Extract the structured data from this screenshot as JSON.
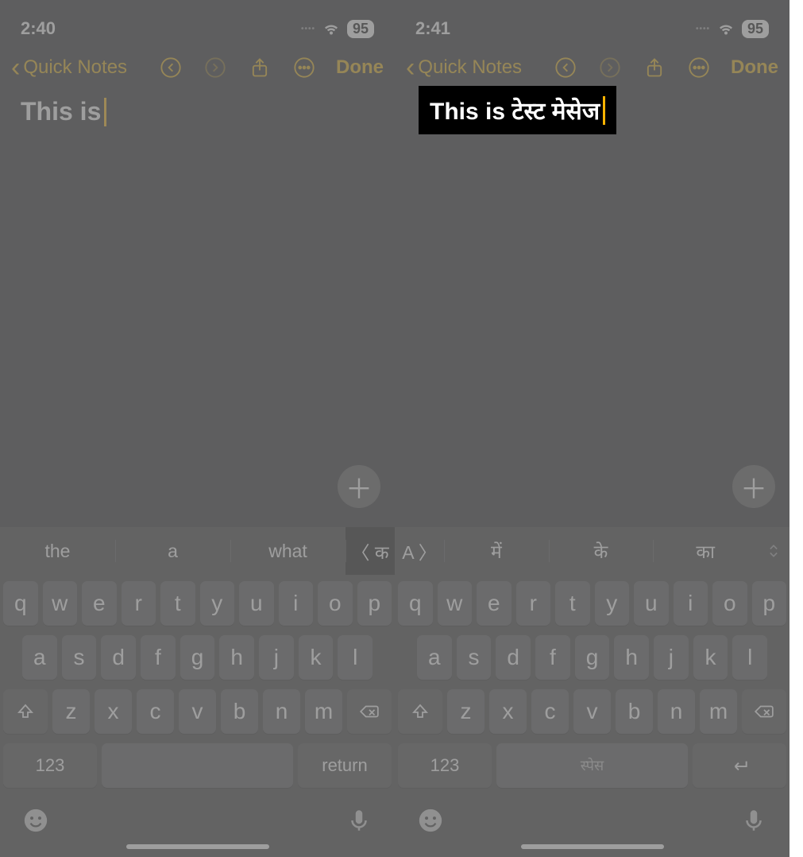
{
  "left": {
    "time": "2:40",
    "battery": "95",
    "back_label": "Quick Notes",
    "done_label": "Done",
    "note_text": "This is",
    "suggestions": [
      "the",
      "a",
      "what"
    ],
    "lang_toggle": "〈 क",
    "keys_row1": [
      "q",
      "w",
      "e",
      "r",
      "t",
      "y",
      "u",
      "i",
      "o",
      "p"
    ],
    "keys_row2": [
      "a",
      "s",
      "d",
      "f",
      "g",
      "h",
      "j",
      "k",
      "l"
    ],
    "keys_row3": [
      "z",
      "x",
      "c",
      "v",
      "b",
      "n",
      "m"
    ],
    "num_key": "123",
    "space_label": "",
    "return_label": "return"
  },
  "right": {
    "time": "2:41",
    "battery": "95",
    "back_label": "Quick Notes",
    "done_label": "Done",
    "note_text": "This is टेस्ट मेसेज",
    "lang_toggle": "A 〉",
    "suggestions": [
      "में",
      "के",
      "का"
    ],
    "keys_row1": [
      "q",
      "w",
      "e",
      "r",
      "t",
      "y",
      "u",
      "i",
      "o",
      "p"
    ],
    "keys_row2": [
      "a",
      "s",
      "d",
      "f",
      "g",
      "h",
      "j",
      "k",
      "l"
    ],
    "keys_row3": [
      "z",
      "x",
      "c",
      "v",
      "b",
      "n",
      "m"
    ],
    "num_key": "123",
    "space_label": "स्पेस",
    "return_label": "↵"
  }
}
